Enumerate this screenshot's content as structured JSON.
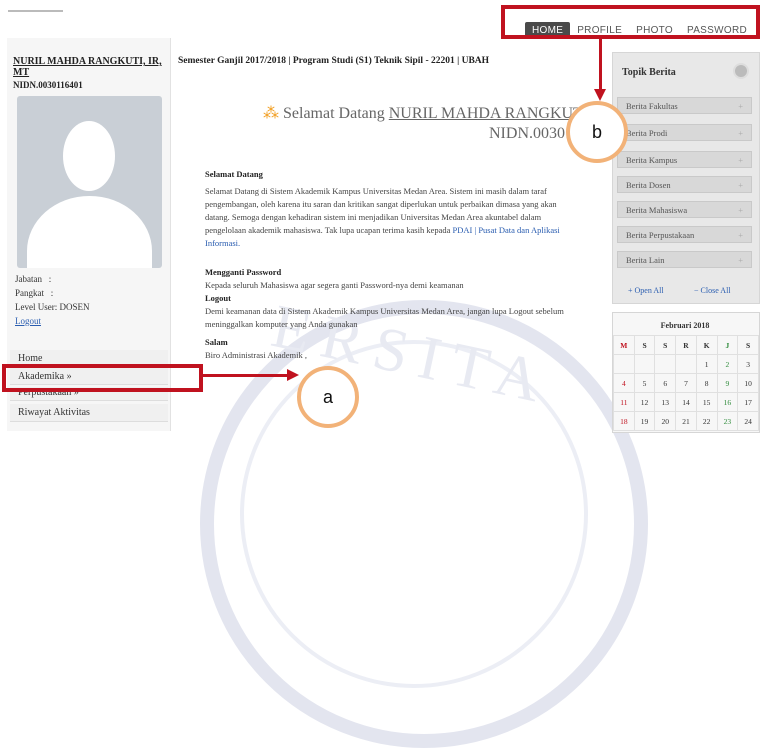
{
  "nav": {
    "home": "HOME",
    "profile": "PROFILE",
    "photo": "PHOTO",
    "password": "PASSWORD"
  },
  "user": {
    "name": "NURIL MAHDA RANGKUTI, IR, MT",
    "nidn": "NIDN.0030116401",
    "jabatan_label": "Jabatan",
    "jabatan_value": ":",
    "pangkat_label": "Pangkat",
    "pangkat_value": ":",
    "level": "Level User: DOSEN",
    "logout": "Logout"
  },
  "menu": {
    "home": "Home",
    "akademika": "Akademika »",
    "perpustakaan": "Perpustakaan »",
    "riwayat": "Riwayat Aktivitas"
  },
  "main": {
    "header": "Semester Ganjil 2017/2018 | Program Studi (S1) Teknik Sipil - 22201 | UBAH",
    "welcome_prefix": "Selamat Datang",
    "welcome_name": "NURIL MAHDA RANGKUTI, IR",
    "welcome_nidn": "NIDN.00301",
    "sec1_title": "Selamat Datang",
    "sec1_body": "Selamat Datang di Sistem Akademik Kampus Universitas Medan Area. Sistem ini masih dalam taraf pengembangan, oleh karena itu saran dan kritikan sangat diperlukan untuk perbaikan dimasa yang akan datang. Semoga dengan kehadiran sistem ini menjadikan Universitas Medan Area akuntabel dalam pengelolaan akademik mahasiswa. Tak lupa ucapan terima kasih kepada",
    "sec1_link": "PDAI | Pusat Data dan Aplikasi Informasi.",
    "sec2_title": "Mengganti Password",
    "sec2_body": "Kepada seluruh Mahasiswa agar segera ganti Password-nya demi keamanan",
    "sec3_title": "Logout",
    "sec3_body": "Demi keamanan data di Sistem Akademik Kampus Universitas Medan Area, jangan lupa Logout sebelum meninggalkan komputer yang Anda gunakan",
    "sec4_title": "Salam",
    "sec4_body": "Biro Administrasi Akademik ,"
  },
  "topik": {
    "title": "Topik Berita",
    "items": [
      "Berita Fakultas",
      "Berita Prodi",
      "Berita Kampus",
      "Berita Dosen",
      "Berita Mahasiswa",
      "Berita Perpustakaan",
      "Berita Lain"
    ],
    "open_all": "Open All",
    "close_all": "Close All"
  },
  "calendar": {
    "title": "Februari 2018",
    "days": [
      "M",
      "S",
      "S",
      "R",
      "K",
      "J",
      "S"
    ],
    "rows": [
      [
        "",
        "",
        "",
        "",
        "1",
        "2",
        "3"
      ],
      [
        "4",
        "5",
        "6",
        "7",
        "8",
        "9",
        "10"
      ],
      [
        "11",
        "12",
        "13",
        "14",
        "15",
        "16",
        "17"
      ],
      [
        "18",
        "19",
        "20",
        "21",
        "22",
        "23",
        "24"
      ]
    ]
  },
  "annotations": {
    "label_a": "a",
    "label_b": "b",
    "accent_red": "#c0121f",
    "circle_orange": "#f2b278"
  }
}
